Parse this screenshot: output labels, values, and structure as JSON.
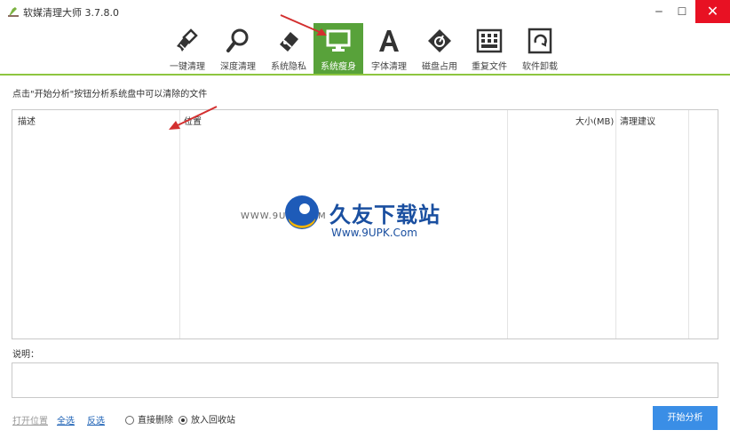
{
  "window": {
    "title": "软媒清理大师 3.7.8.0",
    "min_glyph": "‒",
    "max_glyph": "☐",
    "close_glyph": "✕"
  },
  "toolbar": {
    "items": [
      {
        "label": "一键清理",
        "icon": "broom-icon"
      },
      {
        "label": "深度清理",
        "icon": "magnifier-icon"
      },
      {
        "label": "系统隐私",
        "icon": "eraser-icon"
      },
      {
        "label": "系统瘦身",
        "icon": "monitor-icon",
        "active": true
      },
      {
        "label": "字体清理",
        "icon": "font-icon"
      },
      {
        "label": "磁盘占用",
        "icon": "disk-tag-icon"
      },
      {
        "label": "重复文件",
        "icon": "grid-icon"
      },
      {
        "label": "软件卸载",
        "icon": "recycle-icon"
      }
    ]
  },
  "hint": "点击\"开始分析\"按钮分析系统盘中可以清除的文件",
  "table": {
    "columns": [
      "描述",
      "位置",
      "大小(MB)",
      "清理建议"
    ],
    "rows": []
  },
  "watermark": {
    "cn": "久友下载站",
    "en": "Www.9UPK.Com",
    "small": "WWW.9UPK.COM"
  },
  "description": {
    "label": "说明：",
    "value": ""
  },
  "bottom": {
    "open_location": "打开位置",
    "select_all": "全选",
    "invert": "反选",
    "radio_direct": "直接删除",
    "radio_recycle": "放入回收站",
    "selected_radio": "放入回收站",
    "start_button": "开始分析"
  },
  "colors": {
    "accent_green": "#58a23a",
    "divider_green": "#8dc63f",
    "button_blue": "#3a8ee6",
    "close_red": "#e81123"
  }
}
